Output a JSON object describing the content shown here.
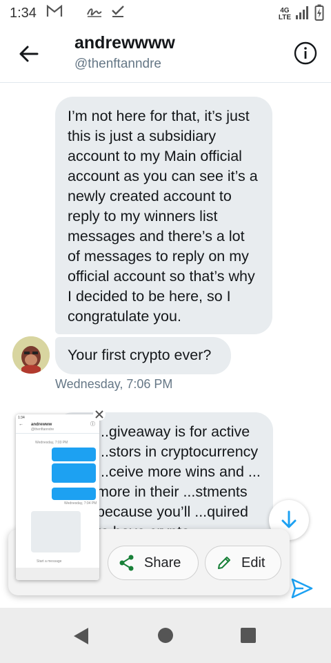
{
  "status_bar": {
    "time": "1:34",
    "network": {
      "line1": "4G",
      "line2": "LTE"
    }
  },
  "header": {
    "title": "andrewwww",
    "handle": "@thenftanndre"
  },
  "messages": [
    {
      "text": "I’m not here for that, it’s just this is just a subsidiary account to my Main official account as you can see it’s a newly created account to reply to my winners list messages and there’s a lot of messages to reply on my official account so that’s why I decided to be here, so I congratulate you."
    },
    {
      "text": "Your first crypto ever?"
    },
    {
      "text": "...giveaway is for active ...stors in cryptocurrency ...ceive more wins and ... more in their ...stments because you’ll ...quired to have crypto"
    }
  ],
  "timestamp": "Wednesday, 7:06 PM",
  "screenshot_actions": {
    "share_label": "Share",
    "edit_label": "Edit"
  },
  "thumbnail": {
    "title": "andrewww",
    "handle": "@thenftanndre",
    "timestamp1": "Wednesday, 7:03 PM",
    "timestamp2": "Wednesday, 7:04 PM",
    "composer_placeholder": "Start a message"
  },
  "colors": {
    "accent": "#1da1f2",
    "bubble": "#e8ecef",
    "secondary_text": "#657786"
  },
  "icons": [
    "gmail-icon",
    "signature-icon",
    "check-icon",
    "signal-icon",
    "battery-icon",
    "back-arrow-icon",
    "info-icon",
    "arrow-down-icon",
    "share-icon",
    "edit-icon",
    "send-icon",
    "close-icon",
    "nav-back-icon",
    "nav-home-icon",
    "nav-recents-icon"
  ]
}
